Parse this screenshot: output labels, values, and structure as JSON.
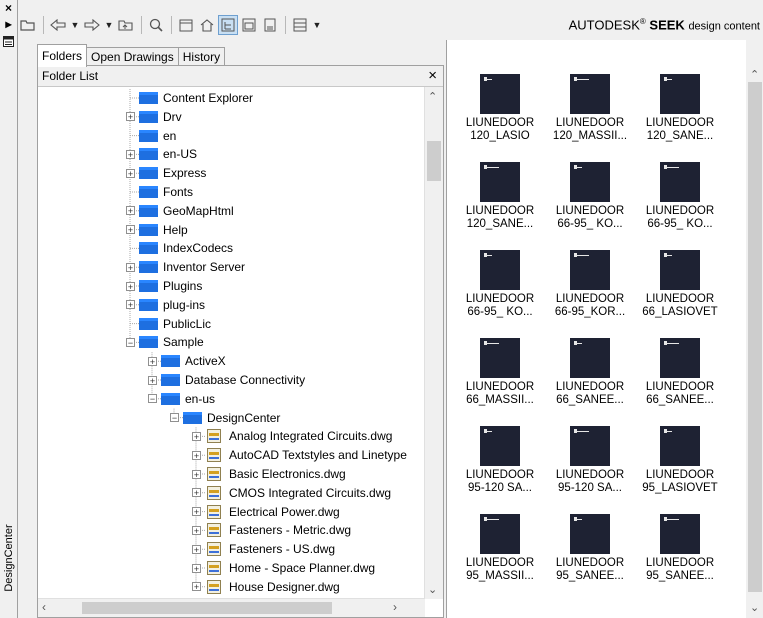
{
  "palette": {
    "app_bg": "#f0f0f0",
    "folder_blue": "#1e6fe0",
    "thumb_bg": "#1e2233",
    "border": "#a0a0a0"
  },
  "left_strip": {
    "close_glyph": "×",
    "collapse_glyph": "▸",
    "icons": [
      "close-icon",
      "autohide-icon",
      "properties-icon"
    ],
    "title": "DesignCenter"
  },
  "toolbar": {
    "buttons": [
      "load-icon",
      "back-icon",
      "forward-icon",
      "up-icon",
      "search-icon",
      "favorites-icon",
      "home-icon",
      "tree-view-toggle-icon",
      "preview-icon",
      "description-icon",
      "views-icon"
    ],
    "brand": {
      "company": "AUTODESK",
      "reg": "®",
      "product": "SEEK",
      "suffix": "design content"
    }
  },
  "tabs": [
    {
      "label": "Folders",
      "active": true
    },
    {
      "label": "Open Drawings",
      "active": false
    },
    {
      "label": "History",
      "active": false
    }
  ],
  "folder_list": {
    "header": "Folder List",
    "close_glyph": "×",
    "nodes": [
      {
        "label": "Content Explorer",
        "depth": 0,
        "expander": "",
        "kind": "folder"
      },
      {
        "label": "Drv",
        "depth": 0,
        "expander": "+",
        "kind": "folder"
      },
      {
        "label": "en",
        "depth": 0,
        "expander": "",
        "kind": "folder"
      },
      {
        "label": "en-US",
        "depth": 0,
        "expander": "+",
        "kind": "folder"
      },
      {
        "label": "Express",
        "depth": 0,
        "expander": "+",
        "kind": "folder"
      },
      {
        "label": "Fonts",
        "depth": 0,
        "expander": "",
        "kind": "folder"
      },
      {
        "label": "GeoMapHtml",
        "depth": 0,
        "expander": "+",
        "kind": "folder"
      },
      {
        "label": "Help",
        "depth": 0,
        "expander": "+",
        "kind": "folder"
      },
      {
        "label": "IndexCodecs",
        "depth": 0,
        "expander": "",
        "kind": "folder"
      },
      {
        "label": "Inventor Server",
        "depth": 0,
        "expander": "+",
        "kind": "folder"
      },
      {
        "label": "Plugins",
        "depth": 0,
        "expander": "+",
        "kind": "folder"
      },
      {
        "label": "plug-ins",
        "depth": 0,
        "expander": "+",
        "kind": "folder"
      },
      {
        "label": "PublicLic",
        "depth": 0,
        "expander": "",
        "kind": "folder"
      },
      {
        "label": "Sample",
        "depth": 0,
        "expander": "−",
        "kind": "folder"
      },
      {
        "label": "ActiveX",
        "depth": 1,
        "expander": "+",
        "kind": "folder"
      },
      {
        "label": "Database Connectivity",
        "depth": 1,
        "expander": "+",
        "kind": "folder"
      },
      {
        "label": "en-us",
        "depth": 1,
        "expander": "−",
        "kind": "folder"
      },
      {
        "label": "DesignCenter",
        "depth": 2,
        "expander": "−",
        "kind": "folder"
      },
      {
        "label": "Analog Integrated Circuits.dwg",
        "depth": 3,
        "expander": "+",
        "kind": "dwg"
      },
      {
        "label": "AutoCAD Textstyles and Linetype",
        "depth": 3,
        "expander": "+",
        "kind": "dwg"
      },
      {
        "label": "Basic Electronics.dwg",
        "depth": 3,
        "expander": "+",
        "kind": "dwg"
      },
      {
        "label": "CMOS Integrated Circuits.dwg",
        "depth": 3,
        "expander": "+",
        "kind": "dwg"
      },
      {
        "label": "Electrical Power.dwg",
        "depth": 3,
        "expander": "+",
        "kind": "dwg"
      },
      {
        "label": "Fasteners - Metric.dwg",
        "depth": 3,
        "expander": "+",
        "kind": "dwg"
      },
      {
        "label": "Fasteners - US.dwg",
        "depth": 3,
        "expander": "+",
        "kind": "dwg"
      },
      {
        "label": "Home - Space Planner.dwg",
        "depth": 3,
        "expander": "+",
        "kind": "dwg"
      },
      {
        "label": "House Designer.dwg",
        "depth": 3,
        "expander": "+",
        "kind": "dwg"
      }
    ]
  },
  "content": {
    "items": [
      {
        "l1": "LIUNEDOOR",
        "l2": "120_LASIO"
      },
      {
        "l1": "LIUNEDOOR",
        "l2": "120_MASSII..."
      },
      {
        "l1": "LIUNEDOOR",
        "l2": "120_SANE..."
      },
      {
        "l1": "LIUNEDOOR",
        "l2": "120_SANE..."
      },
      {
        "l1": "LIUNEDOOR",
        "l2": "66-95_ KO..."
      },
      {
        "l1": "LIUNEDOOR",
        "l2": "66-95_ KO..."
      },
      {
        "l1": "LIUNEDOOR",
        "l2": "66-95_ KO..."
      },
      {
        "l1": "LIUNEDOOR",
        "l2": "66-95_KOR..."
      },
      {
        "l1": "LIUNEDOOR",
        "l2": "66_LASIOVET"
      },
      {
        "l1": "LIUNEDOOR",
        "l2": "66_MASSII..."
      },
      {
        "l1": "LIUNEDOOR",
        "l2": "66_SANEE..."
      },
      {
        "l1": "LIUNEDOOR",
        "l2": "66_SANEE..."
      },
      {
        "l1": "LIUNEDOOR",
        "l2": "95-120 SA..."
      },
      {
        "l1": "LIUNEDOOR",
        "l2": "95-120 SA..."
      },
      {
        "l1": "LIUNEDOOR",
        "l2": "95_LASIOVET"
      },
      {
        "l1": "LIUNEDOOR",
        "l2": "95_MASSII..."
      },
      {
        "l1": "LIUNEDOOR",
        "l2": "95_SANEE..."
      },
      {
        "l1": "LIUNEDOOR",
        "l2": "95_SANEE..."
      }
    ]
  }
}
